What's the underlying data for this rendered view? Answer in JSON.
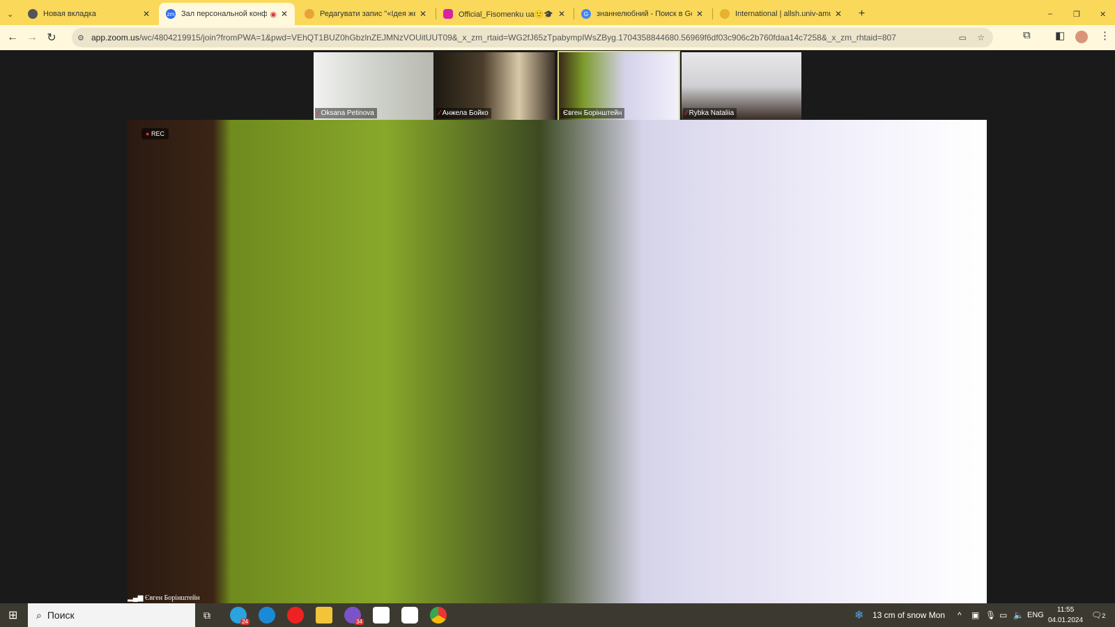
{
  "browser": {
    "tabs": [
      {
        "title": "Новая вкладка",
        "icon": "chrome-icon",
        "active": false
      },
      {
        "title": "Зал персональной конфер",
        "icon": "zoom-icon",
        "active": true,
        "recording": true
      },
      {
        "title": "Редагувати запис \"«Ідея жерт",
        "icon": "wordpress-icon",
        "active": false
      },
      {
        "title": "Official_Fisomenku ua🙂🎓 (@",
        "icon": "instagram-icon",
        "active": false
      },
      {
        "title": "знаннелюбний - Поиск в Goo",
        "icon": "google-icon",
        "active": false
      },
      {
        "title": "International | allsh.univ-amu.fr",
        "icon": "site-icon",
        "active": false
      }
    ],
    "url_host": "app.zoom.us",
    "url_path": "/wc/4804219915/join?fromPWA=1&pwd=VEhQT1BUZ0hGbzlnZEJMNzVOUitUUT09&_x_zm_rtaid=WG2fJ65zTpabympIWsZByg.1704358844680.56969f6df03c906c2b760fdaa14c7258&_x_zm_rhtaid=807",
    "accent": "#f9d85a"
  },
  "meeting": {
    "rec_label": "REC",
    "active_speaker": "Євген Борінштейн",
    "participants": [
      {
        "name": "Oksana Petinova",
        "muted": true
      },
      {
        "name": "Анжела Бойко",
        "muted": true
      },
      {
        "name": "Євген Борінштейн",
        "muted": false,
        "active": true
      },
      {
        "name": "Rybka Nataliia",
        "muted": true
      }
    ]
  },
  "taskbar": {
    "search_placeholder": "Поиск",
    "telegram_badge": "24",
    "viber_badge": "34",
    "weather": "13 cm of snow Mon",
    "lang": "ENG",
    "time": "11:55",
    "date": "04.01.2024",
    "notifications": "2"
  }
}
